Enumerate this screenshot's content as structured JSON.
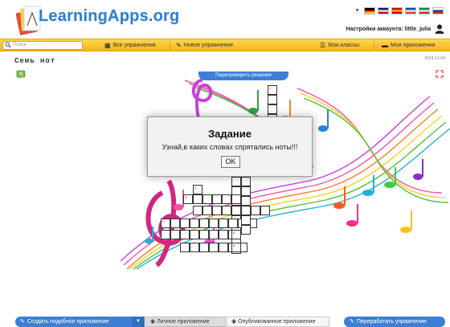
{
  "header": {
    "logo_text": "LearningApps.org",
    "account_label": "Настройки аккаунта: little_julia",
    "flags": [
      {
        "name": "de-flag",
        "colors": [
          "#000000",
          "#dd0000",
          "#ffce00"
        ]
      },
      {
        "name": "uk-flag",
        "colors": [
          "#012169",
          "#ffffff",
          "#c8102e"
        ]
      },
      {
        "name": "es-flag",
        "colors": [
          "#c60b1e",
          "#ffc400",
          "#c60b1e"
        ]
      },
      {
        "name": "fr-flag",
        "colors": [
          "#0055a4",
          "#ffffff",
          "#ef4135"
        ]
      },
      {
        "name": "it-flag",
        "colors": [
          "#009246",
          "#ffffff",
          "#ce2b37"
        ]
      },
      {
        "name": "ru-flag",
        "colors": [
          "#ffffff",
          "#0039a6",
          "#d52b1e"
        ]
      }
    ]
  },
  "nav": {
    "search_placeholder": "Поиск",
    "all_exercises": "Все упражнения",
    "new_exercise": "Новое упражнение",
    "my_classes": "Мои классы",
    "my_apps": "Мои приложения"
  },
  "page": {
    "title": "Семь нот",
    "date": "2014-12-04",
    "recheck_label": "Перепроверить решение"
  },
  "crossword": {
    "numbers": [
      "1",
      "2",
      "3",
      "4",
      "5",
      "6"
    ]
  },
  "dialog": {
    "title": "Задание",
    "text": "Узнай,в каких словах спрятались ноты!!!",
    "ok_label": "OK"
  },
  "footer": {
    "create_label": "Создать подобное приложение",
    "private_label": "Личное приложение",
    "public_label": "Опубликованное приложение",
    "rework_label": "Переработать упражнение"
  },
  "colors": {
    "accent_blue": "#3d7fd6",
    "nav_yellow": "#f7b51c",
    "logo_blue": "#2f7fd1"
  }
}
